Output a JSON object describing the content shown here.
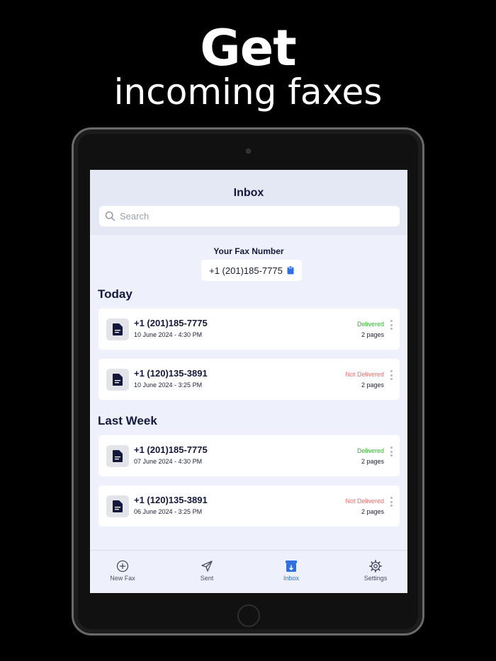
{
  "hero": {
    "title": "Get",
    "subtitle": "incoming faxes"
  },
  "screen": {
    "title": "Inbox",
    "search_placeholder": "Search",
    "fax_label": "Your Fax Number",
    "fax_number": "+1 (201)185-7775"
  },
  "sections": [
    {
      "heading": "Today",
      "items": [
        {
          "number": "+1 (201)185-7775",
          "date": "10 June 2024 - 4:30 PM",
          "status": "Delivered",
          "pages": "2 pages"
        },
        {
          "number": "+1 (120)135-3891",
          "date": "10 June 2024 - 3:25 PM",
          "status": "Not Delivered",
          "pages": "2 pages"
        }
      ]
    },
    {
      "heading": "Last Week",
      "items": [
        {
          "number": "+1 (201)185-7775",
          "date": "07 June 2024 - 4:30 PM",
          "status": "Delivered",
          "pages": "2 pages"
        },
        {
          "number": "+1 (120)135-3891",
          "date": "06 June 2024 - 3:25 PM",
          "status": "Not Delivered",
          "pages": "2 pages"
        }
      ]
    }
  ],
  "tabs": [
    {
      "label": "New Fax",
      "icon": "plus-circle-icon",
      "active": false
    },
    {
      "label": "Sent",
      "icon": "paper-plane-icon",
      "active": false
    },
    {
      "label": "Inbox",
      "icon": "inbox-tray-icon",
      "active": true
    },
    {
      "label": "Settings",
      "icon": "gear-icon",
      "active": false
    }
  ],
  "colors": {
    "accent": "#2f6fe0",
    "delivered": "#2ab52a",
    "not_delivered": "#e66b6b",
    "title_text": "#14183a"
  }
}
